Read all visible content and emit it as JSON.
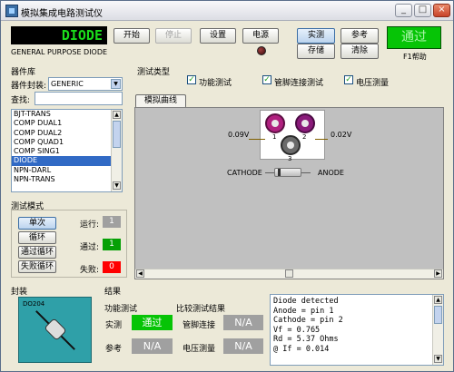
{
  "window": {
    "title": "模拟集成电路测试仪",
    "min": "_",
    "max": "□",
    "close": "×"
  },
  "toolbar": {
    "device_display": "DIODE",
    "device_subtitle": "GENERAL PURPOSE DIODE",
    "start": "开始",
    "stop": "停止",
    "settings": "设置",
    "power": "电源",
    "actual": "实测",
    "reference": "参考",
    "save": "存储",
    "clear": "清除",
    "pass_display": "通过",
    "help": "F1帮助"
  },
  "library": {
    "title": "器件库",
    "package_label": "器件封装:",
    "package_value": "GENERIC",
    "search_label": "查找:",
    "search_value": "",
    "items": [
      "BJT-TRANS",
      "COMP DUAL1",
      "COMP DUAL2",
      "COMP QUAD1",
      "COMP SING1",
      "DIODE",
      "NPN-DARL",
      "NPN-TRANS"
    ],
    "selected_index": 5
  },
  "test_mode": {
    "title": "测试模式",
    "single": "单次",
    "loop": "循环",
    "pass_loop": "通过循环",
    "fail_loop": "失败循环",
    "run_label": "运行:",
    "run_value": "1",
    "pass_label": "通过:",
    "pass_value": "1",
    "fail_label": "失败:",
    "fail_value": "0"
  },
  "test_type": {
    "title": "测试类型",
    "functional": "功能测试",
    "pin_connect": "管脚连接测试",
    "voltage": "电压测量",
    "curve_tab": "模拟曲线"
  },
  "diagram": {
    "left_voltage": "0.09V",
    "right_voltage": "0.02V",
    "pin1": "1",
    "pin2": "2",
    "pin3": "3",
    "cathode": "CATHODE",
    "anode": "ANODE"
  },
  "package_panel": {
    "title": "封装",
    "package_name": "DO204"
  },
  "results": {
    "title": "结果",
    "func_test_label": "功能测试",
    "compare_label": "比较测试结果",
    "actual_label": "实测",
    "actual_value": "通过",
    "reference_label": "参考",
    "reference_value": "N/A",
    "pin_connect_label": "管脚连接",
    "pin_connect_value": "N/A",
    "voltage_label": "电压测量",
    "voltage_value": "N/A",
    "report_lines": [
      "Diode detected",
      "Anode = pin 1",
      "Cathode = pin 2",
      "Vf = 0.765",
      "Rd = 5.37 Ohms",
      "@ If = 0.014"
    ]
  },
  "colors": {
    "lcd_green": "#1bdc1b",
    "pass_green": "#06c406",
    "fail_red": "#ff0000",
    "pin1": "#b0207f",
    "pin2": "#8a1a7a",
    "pin3": "#5a5a5a"
  }
}
